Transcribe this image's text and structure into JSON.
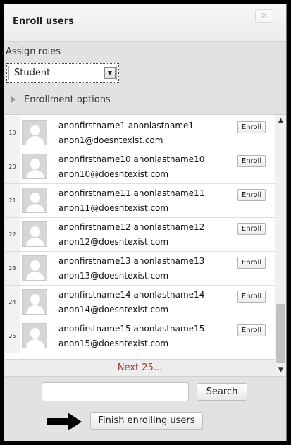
{
  "dialog": {
    "title": "Enroll users",
    "close_label": "×"
  },
  "assign_roles": {
    "label": "Assign roles",
    "selected": "Student"
  },
  "enrollment_options": {
    "label": "Enrollment options"
  },
  "users": [
    {
      "num": "19",
      "name": "anonfirstname1 anonlastname1",
      "email": "anon1@doesntexist.com",
      "action": "Enroll"
    },
    {
      "num": "20",
      "name": "anonfirstname10 anonlastname10",
      "email": "anon10@doesntexist.com",
      "action": "Enroll"
    },
    {
      "num": "21",
      "name": "anonfirstname11 anonlastname11",
      "email": "anon11@doesntexist.com",
      "action": "Enroll"
    },
    {
      "num": "22",
      "name": "anonfirstname12 anonlastname12",
      "email": "anon12@doesntexist.com",
      "action": "Enroll"
    },
    {
      "num": "23",
      "name": "anonfirstname13 anonlastname13",
      "email": "anon13@doesntexist.com",
      "action": "Enroll"
    },
    {
      "num": "24",
      "name": "anonfirstname14 anonlastname14",
      "email": "anon14@doesntexist.com",
      "action": "Enroll"
    },
    {
      "num": "25",
      "name": "anonfirstname15 anonlastname15",
      "email": "anon15@doesntexist.com",
      "action": "Enroll"
    }
  ],
  "pagination": {
    "next_label": "Next 25..."
  },
  "search": {
    "value": "",
    "button_label": "Search"
  },
  "footer": {
    "finish_label": "Finish enrolling users"
  },
  "icons": {
    "close": "close-icon",
    "dropdown": "chevron-down-icon",
    "expand": "triangle-right-icon",
    "avatar": "user-avatar-icon",
    "pointer": "arrow-right-icon"
  },
  "colors": {
    "next_link": "#a03232",
    "dialog_bg": "#e2e2e2"
  }
}
